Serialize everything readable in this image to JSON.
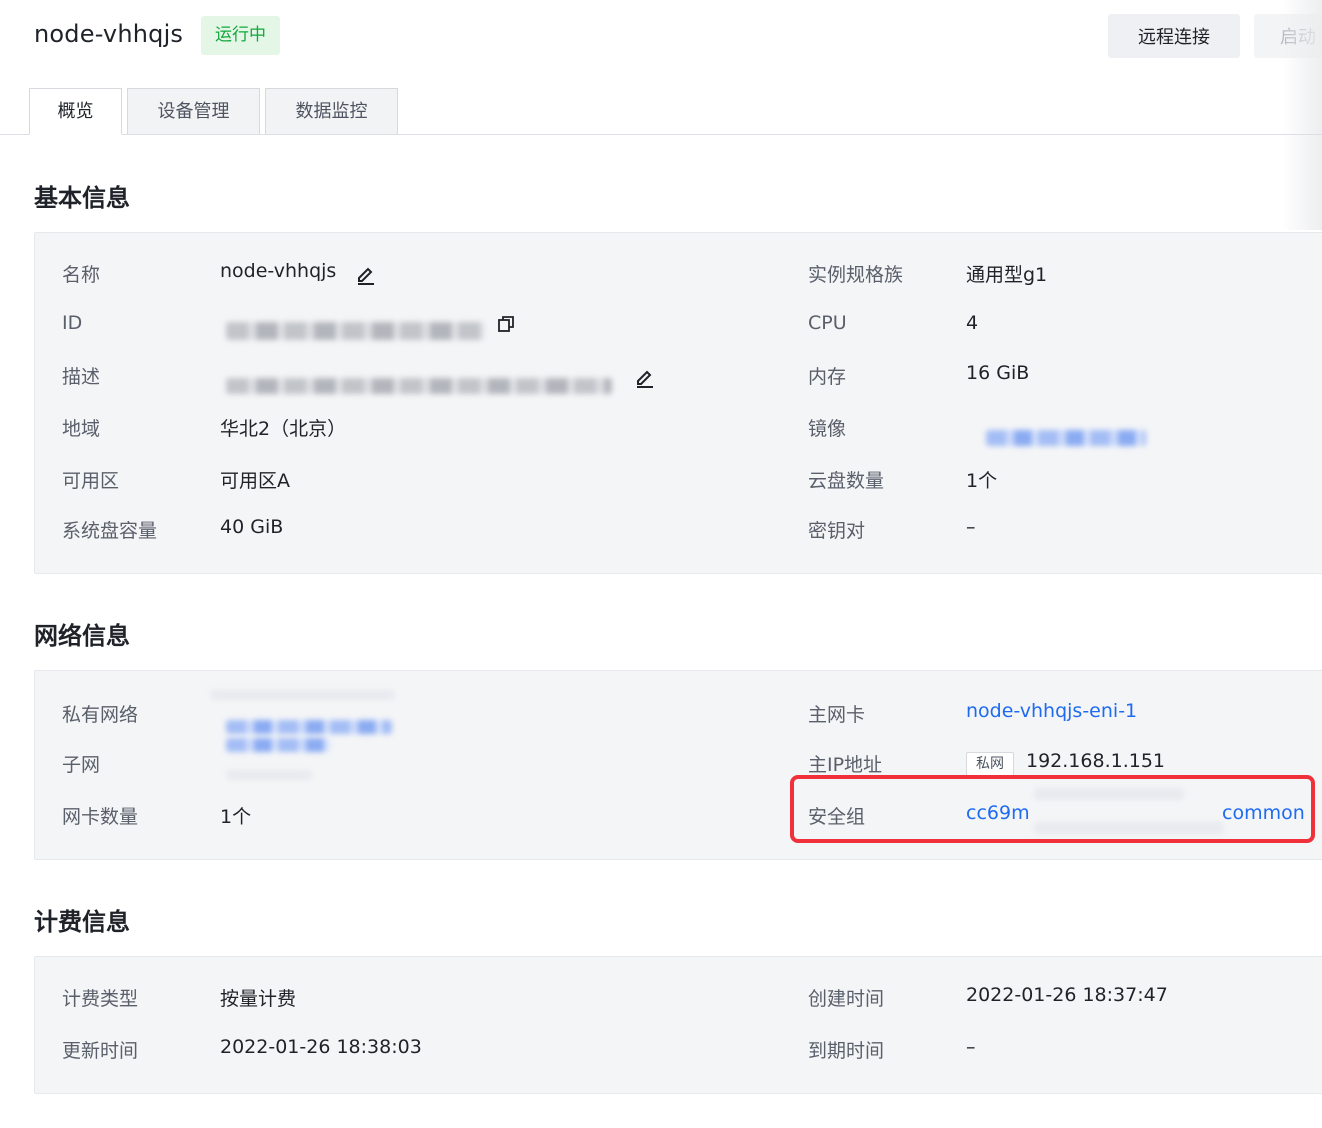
{
  "header": {
    "node_name": "node-vhhqjs",
    "status": "运行中",
    "remote_button": "远程连接",
    "start_button": "启动"
  },
  "tabs": [
    {
      "label": "概览",
      "active": true
    },
    {
      "label": "设备管理",
      "active": false
    },
    {
      "label": "数据监控",
      "active": false
    }
  ],
  "basic": {
    "title": "基本信息",
    "name_label": "名称",
    "name_value": "node-vhhqjs",
    "id_label": "ID",
    "desc_label": "描述",
    "region_label": "地域",
    "region_value": "华北2（北京）",
    "zone_label": "可用区",
    "zone_value": "可用区A",
    "disk_label": "系统盘容量",
    "disk_value": "40 GiB",
    "family_label": "实例规格族",
    "family_value": "通用型g1",
    "cpu_label": "CPU",
    "cpu_value": "4",
    "mem_label": "内存",
    "mem_value": "16 GiB",
    "image_label": "镜像",
    "disk_count_label": "云盘数量",
    "disk_count_value": "1个",
    "keypair_label": "密钥对",
    "keypair_value": "–"
  },
  "network": {
    "title": "网络信息",
    "vpc_label": "私有网络",
    "subnet_label": "子网",
    "nic_count_label": "网卡数量",
    "nic_count_value": "1个",
    "primary_nic_label": "主网卡",
    "primary_nic_value": "node-vhhqjs-eni-1",
    "primary_ip_label": "主IP地址",
    "ip_tag": "私网",
    "primary_ip_value": "192.168.1.151",
    "sg_label": "安全组",
    "sg_value_prefix": "cc69m",
    "sg_value_suffix": "common"
  },
  "billing": {
    "title": "计费信息",
    "type_label": "计费类型",
    "type_value": "按量计费",
    "updated_label": "更新时间",
    "updated_value": "2022-01-26 18:38:03",
    "created_label": "创建时间",
    "created_value": "2022-01-26 18:37:47",
    "expire_label": "到期时间",
    "expire_value": "–"
  },
  "colors": {
    "accent_link": "#1f6bf0",
    "status_green": "#13a83c",
    "highlight_red": "#f0303a",
    "panel_bg": "#f4f5f7"
  }
}
